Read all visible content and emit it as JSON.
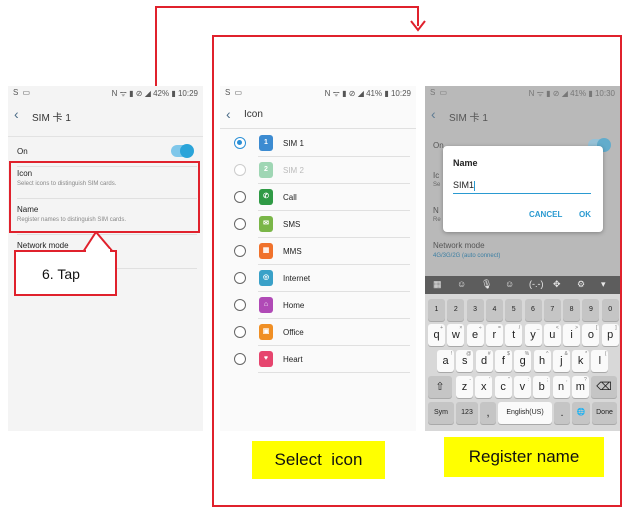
{
  "colors": {
    "annotation_red": "#e0212c",
    "caption_yellow": "#ffff00",
    "accent_blue": "#2a9ad1"
  },
  "status_bar": {
    "screen1": {
      "left": "S ▭",
      "right": "N ᯤ ▮ ⊘ ◢ 42% ▮ 10:29"
    },
    "screen2": {
      "left": "S ▭",
      "right": "N ᯤ ▮ ⊘ ◢ 41% ▮ 10:29"
    },
    "screen3": {
      "left": "S ▭",
      "right": "N ᯤ ▮ ⊘ ◢ 41% ▮ 10:30"
    }
  },
  "screen1": {
    "title": "SIM 卡 1",
    "on_label": "On",
    "icon_label": "Icon",
    "icon_sub": "Select icons to distinguish SIM cards.",
    "name_label": "Name",
    "name_sub": "Register names to distinguish SIM cards.",
    "network_label": "Network mode"
  },
  "screen2": {
    "title": "Icon",
    "items": [
      {
        "label": "SIM 1",
        "badge": "1",
        "color": "#3c8bd1"
      },
      {
        "label": "SIM 2",
        "badge": "2",
        "color": "#9fd6b4"
      },
      {
        "label": "Call",
        "badge": "✆",
        "color": "#2f9a45"
      },
      {
        "label": "SMS",
        "badge": "✉",
        "color": "#7ab648"
      },
      {
        "label": "MMS",
        "badge": "▦",
        "color": "#f0722c"
      },
      {
        "label": "Internet",
        "badge": "◎",
        "color": "#3aa1c8"
      },
      {
        "label": "Home",
        "badge": "⌂",
        "color": "#b04ab6"
      },
      {
        "label": "Office",
        "badge": "▣",
        "color": "#f08f24"
      },
      {
        "label": "Heart",
        "badge": "♥",
        "color": "#e6456e"
      }
    ]
  },
  "screen3": {
    "title": "SIM 卡 1",
    "on_label": "On",
    "icon_label_partial": "Ic",
    "icon_sub_partial": "Se",
    "name_label_partial": "N",
    "name_sub_partial": "Re",
    "network_label": "Network mode",
    "network_value": "4G/3G/2G (auto connect)",
    "dialog": {
      "title": "Name",
      "input_value": "SIM1",
      "cancel": "CANCEL",
      "ok": "OK"
    },
    "keyboard": {
      "toolbar": [
        "▦",
        "☺",
        "🎙",
        "☺",
        "(-.-)",
        "✥",
        "⚙",
        "▾"
      ],
      "row1": [
        "1",
        "2",
        "3",
        "4",
        "5",
        "6",
        "7",
        "8",
        "9",
        "0"
      ],
      "row2": [
        "q",
        "w",
        "e",
        "r",
        "t",
        "y",
        "u",
        "i",
        "o",
        "p"
      ],
      "row2_hints": [
        "+",
        "×",
        "÷",
        "=",
        "/",
        "_",
        "<",
        ">",
        "[",
        "]"
      ],
      "row3": [
        "a",
        "s",
        "d",
        "f",
        "g",
        "h",
        "j",
        "k",
        "l"
      ],
      "row3_hints": [
        "!",
        "@",
        "#",
        "$",
        "%",
        "^",
        "&",
        "*",
        "("
      ],
      "row4": [
        "z",
        "x",
        "c",
        "v",
        "b",
        "n",
        "m"
      ],
      "row4_hints": [
        "-",
        "'",
        "\"",
        ":",
        ";",
        ",",
        "?"
      ],
      "shift": "⇧",
      "backspace": "⌫",
      "sym": "Sym",
      "num": "123",
      "comma": ",",
      "space": "English(US)",
      "period": ".",
      "globe": "🌐",
      "done": "Done"
    }
  },
  "annotations": {
    "callout": "6. Tap",
    "caption_select": "Select  icon",
    "caption_register": "Register name"
  }
}
